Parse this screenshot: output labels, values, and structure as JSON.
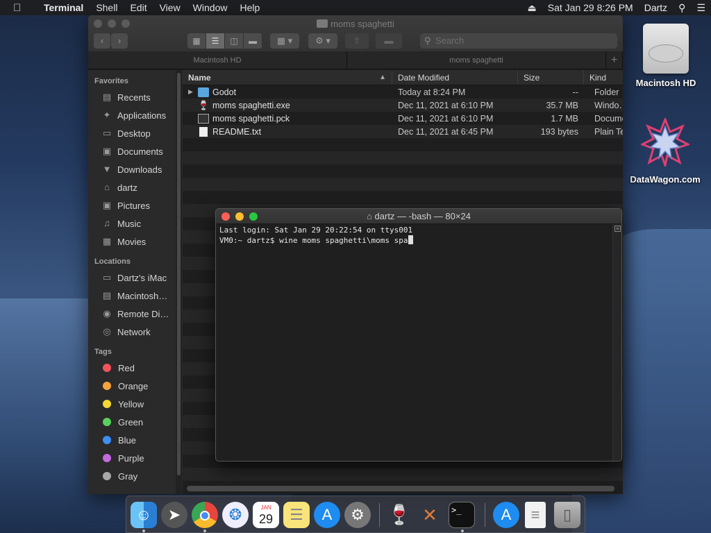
{
  "menubar": {
    "apple_icon": "apple-icon",
    "app_name": "Terminal",
    "menus": [
      "Shell",
      "Edit",
      "View",
      "Window",
      "Help"
    ],
    "datetime": "Sat Jan 29  8:26 PM",
    "user": "Dartz"
  },
  "finder": {
    "title": "moms spaghetti",
    "search_placeholder": "Search",
    "tabs": [
      "Macintosh HD",
      "moms spaghetti"
    ],
    "columns": {
      "name": "Name",
      "date": "Date Modified",
      "size": "Size",
      "kind": "Kind"
    },
    "files": [
      {
        "name": "Godot",
        "date": "Today at 8:24 PM",
        "size": "--",
        "kind": "Folder"
      },
      {
        "name": "moms spaghetti.exe",
        "date": "Dec 11, 2021 at 6:10 PM",
        "size": "35.7 MB",
        "kind": "Windo…"
      },
      {
        "name": "moms spaghetti.pck",
        "date": "Dec 11, 2021 at 6:10 PM",
        "size": "1.7 MB",
        "kind": "Docume"
      },
      {
        "name": "README.txt",
        "date": "Dec 11, 2021 at 6:45 PM",
        "size": "193 bytes",
        "kind": "Plain Te"
      }
    ],
    "sidebar": {
      "favorites_label": "Favorites",
      "favorites": [
        "Recents",
        "Applications",
        "Desktop",
        "Documents",
        "Downloads",
        "dartz",
        "Pictures",
        "Music",
        "Movies"
      ],
      "locations_label": "Locations",
      "locations": [
        "Dartz's iMac",
        "Macintosh…",
        "Remote Di…",
        "Network"
      ],
      "tags_label": "Tags",
      "tags": [
        {
          "name": "Red",
          "color": "#f2545b"
        },
        {
          "name": "Orange",
          "color": "#f7a23a"
        },
        {
          "name": "Yellow",
          "color": "#f5d833"
        },
        {
          "name": "Green",
          "color": "#5ad05e"
        },
        {
          "name": "Blue",
          "color": "#3d8ff5"
        },
        {
          "name": "Purple",
          "color": "#c46ae0"
        },
        {
          "name": "Gray",
          "color": "#a8a8a8"
        }
      ]
    }
  },
  "terminal": {
    "title": "dartz — -bash — 80×24",
    "line1": "Last login: Sat Jan 29 20:22:54 on ttys001",
    "line2": "VM0:~ dartz$ wine moms spaghetti\\moms spa"
  },
  "desktop": {
    "hd_label": "Macintosh HD",
    "dw_label": "DataWagon.com"
  },
  "dock": {
    "calendar_month": "JAN",
    "calendar_day": "29"
  }
}
